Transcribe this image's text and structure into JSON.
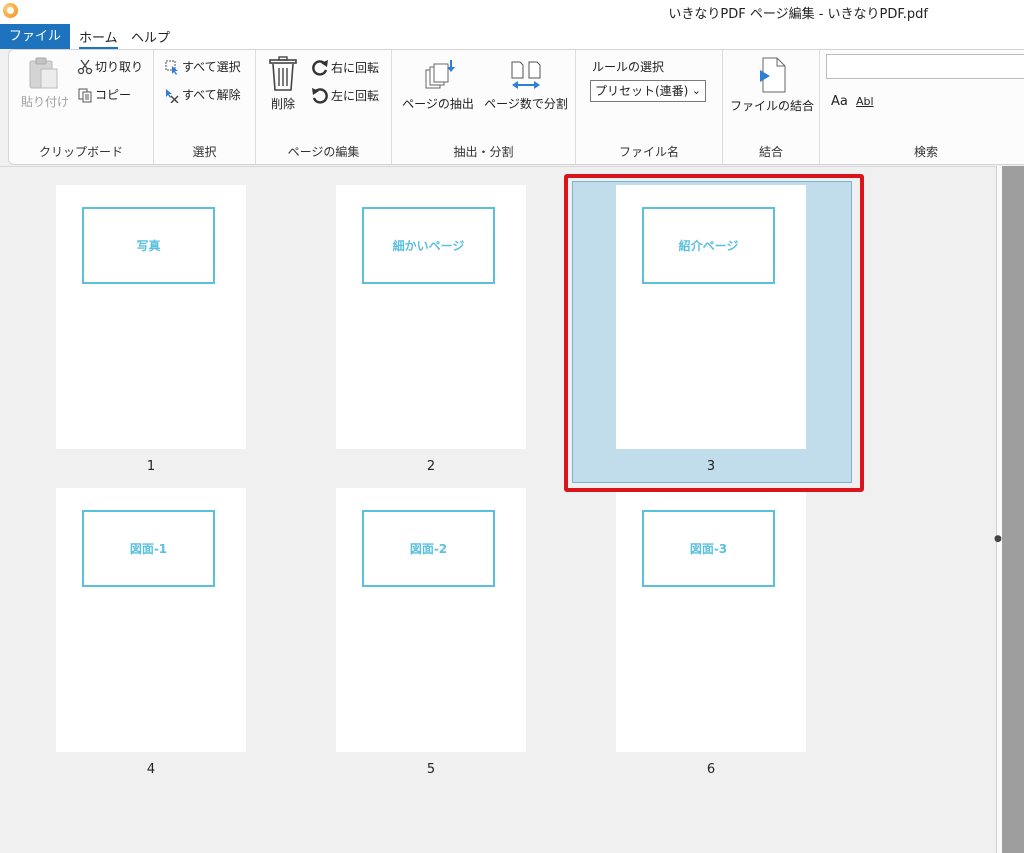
{
  "window": {
    "title": "いきなりPDF ページ編集 - いきなりPDF.pdf"
  },
  "menu": {
    "file": "ファイル",
    "home": "ホーム",
    "help": "ヘルプ"
  },
  "ribbon": {
    "clipboard": {
      "label": "クリップボード",
      "paste": "貼り付け",
      "cut": "切り取り",
      "copy": "コピー"
    },
    "select": {
      "label": "選択",
      "select_all": "すべて選択",
      "deselect_all": "すべて解除"
    },
    "page_edit": {
      "label": "ページの編集",
      "delete": "削除",
      "rotate_right": "右に回転",
      "rotate_left": "左に回転"
    },
    "extract_split": {
      "label": "抽出・分割",
      "extract": "ページの抽出",
      "split": "ページ数で分割"
    },
    "filename": {
      "label": "ファイル名",
      "rule_label": "ルールの選択",
      "rule_value": "プリセット(連番)"
    },
    "combine": {
      "label": "結合",
      "combine_files": "ファイルの結合"
    },
    "search": {
      "label": "検索",
      "match_case": "Aa",
      "whole_word": "Abl"
    }
  },
  "pages": [
    {
      "number": "1",
      "title": "写真"
    },
    {
      "number": "2",
      "title": "細かいページ"
    },
    {
      "number": "3",
      "title": "紹介ページ",
      "selected": true
    },
    {
      "number": "4",
      "title": "図面-1"
    },
    {
      "number": "5",
      "title": "図面-2"
    },
    {
      "number": "6",
      "title": "図面-3"
    }
  ],
  "colors": {
    "accent": "#1e73be",
    "selection_fill": "#c1dcea",
    "highlight_outline": "#d9151b",
    "thumb_text": "#5bc0de"
  }
}
